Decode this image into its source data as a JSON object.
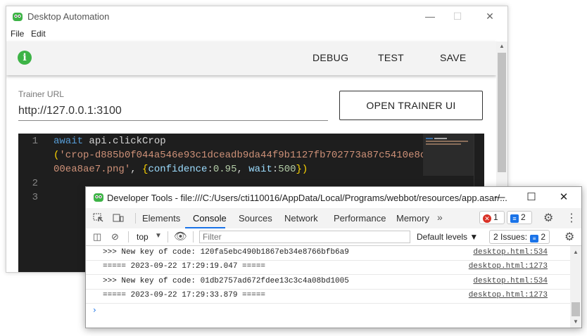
{
  "app": {
    "title": "Desktop Automation",
    "menu": [
      "File",
      "Edit"
    ],
    "toolbar": {
      "info_icon": "i",
      "debug_label": "DEBUG",
      "test_label": "TEST",
      "save_label": "SAVE"
    },
    "trainer": {
      "label": "Trainer URL",
      "value": "http://127.0.0.1:3100",
      "open_label": "OPEN TRAINER UI"
    },
    "editor": {
      "line_numbers": [
        "1",
        "2",
        "3"
      ],
      "line1_kw": "await",
      "line1_call": " api.clickCrop",
      "line2_paren": "(",
      "line2_str1": "'crop-d885b0f044a546e93c1dceadb9da44f9b1127fb702773a87c5410e8c",
      "line3_str2": "00ea8ae7.png'",
      "line3_comma": ", ",
      "line3_brace_open": "{",
      "line3_k1": "confidence",
      "line3_colon1": ":",
      "line3_v1": "0.95",
      "line3_sep": ", ",
      "line3_k2": "wait",
      "line3_colon2": ":",
      "line3_v2": "500",
      "line3_brace_close": "}",
      "line3_paren_close": ")"
    }
  },
  "devtools": {
    "title": "Developer Tools - file:///C:/Users/cti110016/AppData/Local/Programs/webbot/resources/app.asar/...",
    "tabs": [
      "Elements",
      "Console",
      "Sources",
      "Network",
      "Performance",
      "Memory"
    ],
    "active_tab": "Console",
    "more_tabs": "»",
    "error_count": "1",
    "message_count": "2",
    "context": "top",
    "filter_placeholder": "Filter",
    "levels": "Default levels ▼",
    "issues": "2 Issues:",
    "issues_count": "2",
    "prompt": "›",
    "logs": [
      {
        "msg": ">>> New key of code: 120fa5ebc490b1867eb34e8766bfb6a9",
        "src": "desktop.html:534"
      },
      {
        "msg": "===== 2023-09-22 17:29:19.047 =====",
        "src": "desktop.html:1273"
      },
      {
        "msg": ">>> New key of code: 01db2757ad672fdee13c3c4a08bd1005",
        "src": "desktop.html:534"
      },
      {
        "msg": "===== 2023-09-22 17:29:33.879 =====",
        "src": "desktop.html:1273"
      }
    ]
  }
}
